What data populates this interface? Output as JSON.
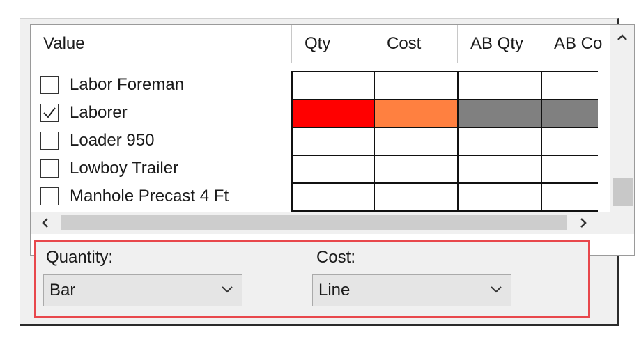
{
  "grid": {
    "columns": [
      "Value",
      "Qty",
      "Cost",
      "AB Qty",
      "AB Co"
    ],
    "rows": [
      {
        "label": "Labor Foreman",
        "checked": false,
        "cells": [
          "#ffffff",
          "#ffffff",
          "#ffffff",
          "#ffffff"
        ]
      },
      {
        "label": "Laborer",
        "checked": true,
        "cells": [
          "#ff0000",
          "#ff8040",
          "#808080",
          "#808080"
        ]
      },
      {
        "label": "Loader 950",
        "checked": false,
        "cells": [
          "#ffffff",
          "#ffffff",
          "#ffffff",
          "#ffffff"
        ]
      },
      {
        "label": "Lowboy Trailer",
        "checked": false,
        "cells": [
          "#ffffff",
          "#ffffff",
          "#ffffff",
          "#ffffff"
        ]
      },
      {
        "label": "Manhole Precast 4 Ft",
        "checked": false,
        "cells": [
          "#ffffff",
          "#ffffff",
          "#ffffff",
          "#ffffff"
        ]
      }
    ]
  },
  "scroll": {
    "up_icon": "chevron-up-icon",
    "left_icon": "chevron-left-icon",
    "right_icon": "chevron-right-icon"
  },
  "options": {
    "quantity_label": "Quantity:",
    "quantity_value": "Bar",
    "cost_label": "Cost:",
    "cost_value": "Line",
    "highlight_color": "#e8474c"
  }
}
